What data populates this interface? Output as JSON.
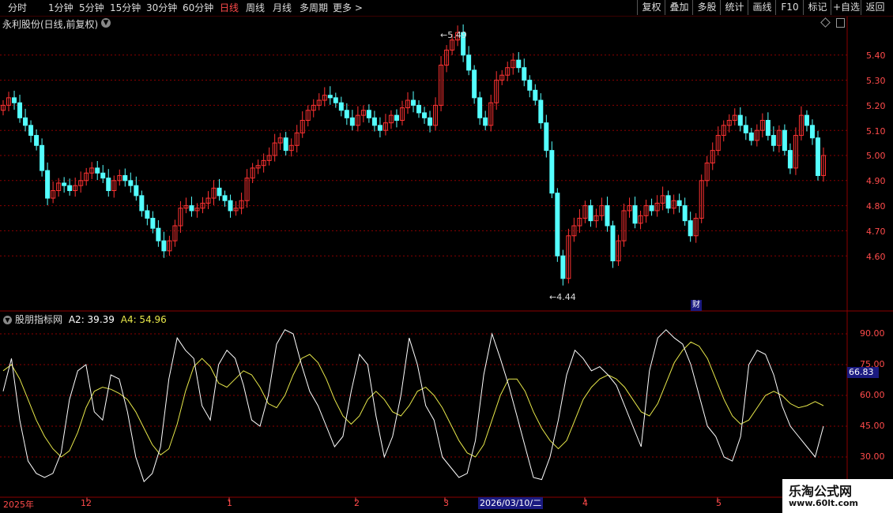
{
  "toolbar": {
    "periods": [
      "分时",
      "1分钟",
      "5分钟",
      "15分钟",
      "30分钟",
      "60分钟",
      "日线",
      "周线",
      "月线",
      "多周期",
      "更多 >"
    ],
    "active_period": "日线",
    "buttons": [
      "复权",
      "叠加",
      "多股",
      "统计",
      "画线",
      "F10",
      "标记",
      "+自选",
      "返回"
    ]
  },
  "stock_title": "永利股份(日线,前复权)",
  "price_axis": [
    "5.40",
    "5.30",
    "5.20",
    "5.10",
    "5.00",
    "4.90",
    "4.80",
    "4.70",
    "4.60"
  ],
  "high_label": "5.49",
  "low_label": "4.44",
  "finance_badge": "财",
  "indicator": {
    "name": "股朋指标网",
    "a2_label": "A2: 39.39",
    "a4_label": "A4: 54.96",
    "axis": [
      "90.00",
      "75.00",
      "60.00",
      "45.00",
      "30.00"
    ],
    "current_value": "66.83"
  },
  "x_axis": {
    "labels": [
      "2025年",
      "12",
      "1",
      "2",
      "3",
      "4",
      "5"
    ],
    "cursor_date": "2026/03/10/二"
  },
  "watermark": {
    "brand": "乐淘公式网",
    "url": "www.60lt.com"
  },
  "colors": {
    "up": "#ff3232",
    "down": "#54ffff",
    "line_white": "#ffffff",
    "line_yellow": "#e8e84a",
    "grid": "#8b0000"
  }
}
